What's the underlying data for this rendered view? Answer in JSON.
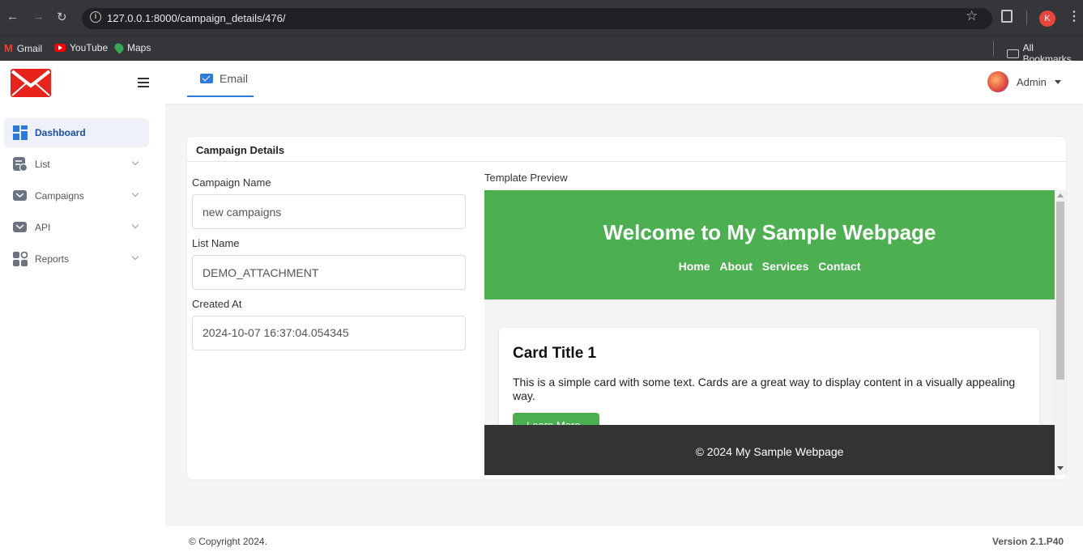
{
  "browser": {
    "url": "127.0.0.1:8000/campaign_details/476/",
    "bookmarks": [
      "Gmail",
      "YouTube",
      "Maps"
    ],
    "all_bookmarks_label": "All Bookmarks",
    "profile_initial": "K"
  },
  "header": {
    "tab_label": "Email",
    "user_name": "Admin"
  },
  "sidebar": {
    "items": [
      {
        "label": "Dashboard",
        "icon": "dashboard-icon",
        "active": true
      },
      {
        "label": "List",
        "icon": "list-icon"
      },
      {
        "label": "Campaigns",
        "icon": "mail-icon"
      },
      {
        "label": "API",
        "icon": "mail-icon"
      },
      {
        "label": "Reports",
        "icon": "reports-icon"
      }
    ]
  },
  "card": {
    "title": "Campaign Details",
    "fields": [
      {
        "label": "Campaign Name",
        "value": "new campaigns"
      },
      {
        "label": "List Name",
        "value": "DEMO_ATTACHMENT"
      },
      {
        "label": "Created At",
        "value": "2024-10-07 16:37:04.054345"
      }
    ],
    "preview_label": "Template Preview"
  },
  "preview": {
    "title": "Welcome to My Sample Webpage",
    "nav": [
      "Home",
      "About",
      "Services",
      "Contact"
    ],
    "card_title": "Card Title 1",
    "card_text": "This is a simple card with some text. Cards are a great way to display content in a visually appealing way.",
    "button_label": "Learn More",
    "footer": "© 2024 My Sample Webpage",
    "accent_color": "#4caf50"
  },
  "footer": {
    "copyright": "© Copyright 2024.",
    "version": "Version 2.1.P40"
  }
}
